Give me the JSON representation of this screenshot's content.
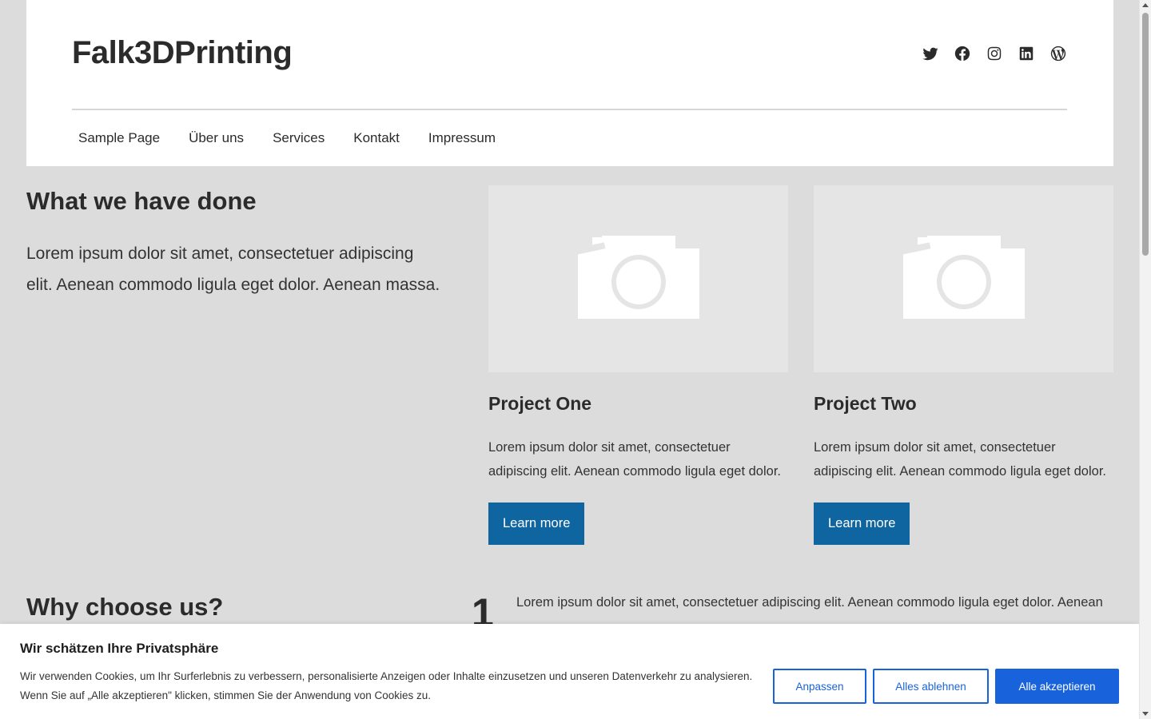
{
  "header": {
    "site_title": "Falk3DPrinting",
    "social_icons": [
      "twitter-icon",
      "facebook-icon",
      "instagram-icon",
      "linkedin-icon",
      "wordpress-icon"
    ],
    "nav": [
      "Sample Page",
      "Über uns",
      "Services",
      "Kontakt",
      "Impressum"
    ]
  },
  "done": {
    "heading": "What we have done",
    "text": "Lorem ipsum dolor sit amet, consectetuer adipiscing elit. Aenean commodo ligula eget dolor. Aenean massa."
  },
  "projects": [
    {
      "title": "Project One",
      "text": "Lorem ipsum dolor sit amet, consectetuer adipiscing elit. Aenean commodo ligula eget dolor.",
      "button": "Learn more"
    },
    {
      "title": "Project Two",
      "text": "Lorem ipsum dolor sit amet, consectetuer adipiscing elit. Aenean commodo ligula eget dolor.",
      "button": "Learn more"
    }
  ],
  "why": {
    "heading": "Why choose us?",
    "number": "1",
    "text": "Lorem ipsum dolor sit amet, consectetuer adipiscing elit. Aenean commodo ligula eget dolor. Aenean"
  },
  "cookie": {
    "title": "Wir schätzen Ihre Privatsphäre",
    "text": "Wir verwenden Cookies, um Ihr Surferlebnis zu verbessern, personalisierte Anzeigen oder Inhalte einzusetzen und unseren Datenverkehr zu analysieren. Wenn Sie auf „Alle akzeptieren\" klicken, stimmen Sie der Anwendung von Cookies zu.",
    "customize_label": "Anpassen",
    "reject_label": "Alles ablehnen",
    "accept_label": "Alle akzeptieren"
  },
  "colors": {
    "accent_button": "#0f65a0",
    "cookie_accent": "#1863dc",
    "page_background": "#dcdcdc"
  }
}
